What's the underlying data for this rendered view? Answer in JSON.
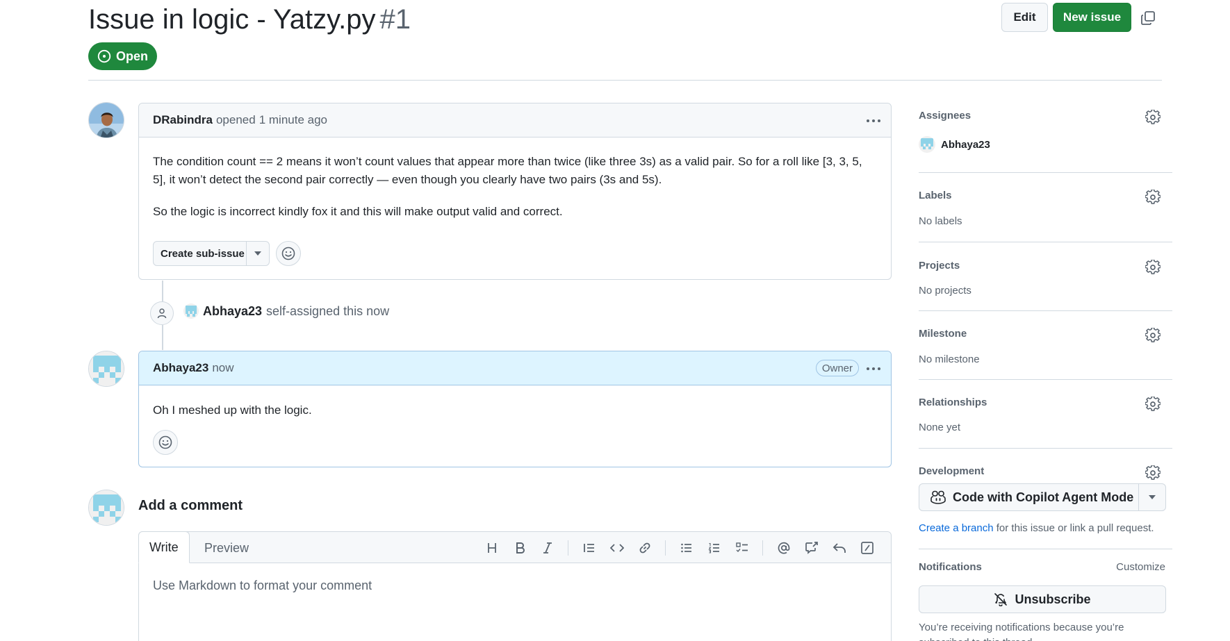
{
  "header": {
    "title": "Issue in logic - Yatzy.py",
    "number": "#1",
    "state": "Open",
    "edit_label": "Edit",
    "new_issue_label": "New issue"
  },
  "comments": [
    {
      "author": "DRabindra",
      "action": "opened",
      "time": "1 minute ago",
      "paragraphs": [
        "The condition count == 2 means it won’t count values that appear more than twice (like three 3s) as a valid pair. So for a roll like [3, 3, 5, 5], it won’t detect the second pair correctly — even though you clearly have two pairs (3s and 5s).",
        "So the logic is incorrect kindly fox it and this will make output valid and correct."
      ],
      "create_sub_issue_label": "Create sub-issue"
    },
    {
      "author": "Abhaya23",
      "time": "now",
      "badge": "Owner",
      "paragraphs": [
        "Oh I meshed up with the logic."
      ]
    }
  ],
  "event": {
    "actor": "Abhaya23",
    "text": "self-assigned this now"
  },
  "composer": {
    "title": "Add a comment",
    "tab_write": "Write",
    "tab_preview": "Preview",
    "placeholder": "Use Markdown to format your comment"
  },
  "sidebar": {
    "assignees": {
      "heading": "Assignees",
      "value": "Abhaya23"
    },
    "labels": {
      "heading": "Labels",
      "value": "No labels"
    },
    "projects": {
      "heading": "Projects",
      "value": "No projects"
    },
    "milestone": {
      "heading": "Milestone",
      "value": "No milestone"
    },
    "relationships": {
      "heading": "Relationships",
      "value": "None yet"
    },
    "development": {
      "heading": "Development",
      "copilot_label": "Code with Copilot Agent Mode",
      "branch_link": "Create a branch",
      "branch_text": "for this issue or link a pull request."
    },
    "notifications": {
      "heading": "Notifications",
      "customize": "Customize",
      "unsubscribe_label": "Unsubscribe",
      "reason_line1": "You’re receiving notifications because you’re",
      "reason_line2": "subscribed to this thread."
    }
  },
  "colors": {
    "open_green": "#1f883d",
    "link_blue": "#0969da",
    "owner_header_bg": "#ddf4ff",
    "border": "#d1d9e0"
  }
}
